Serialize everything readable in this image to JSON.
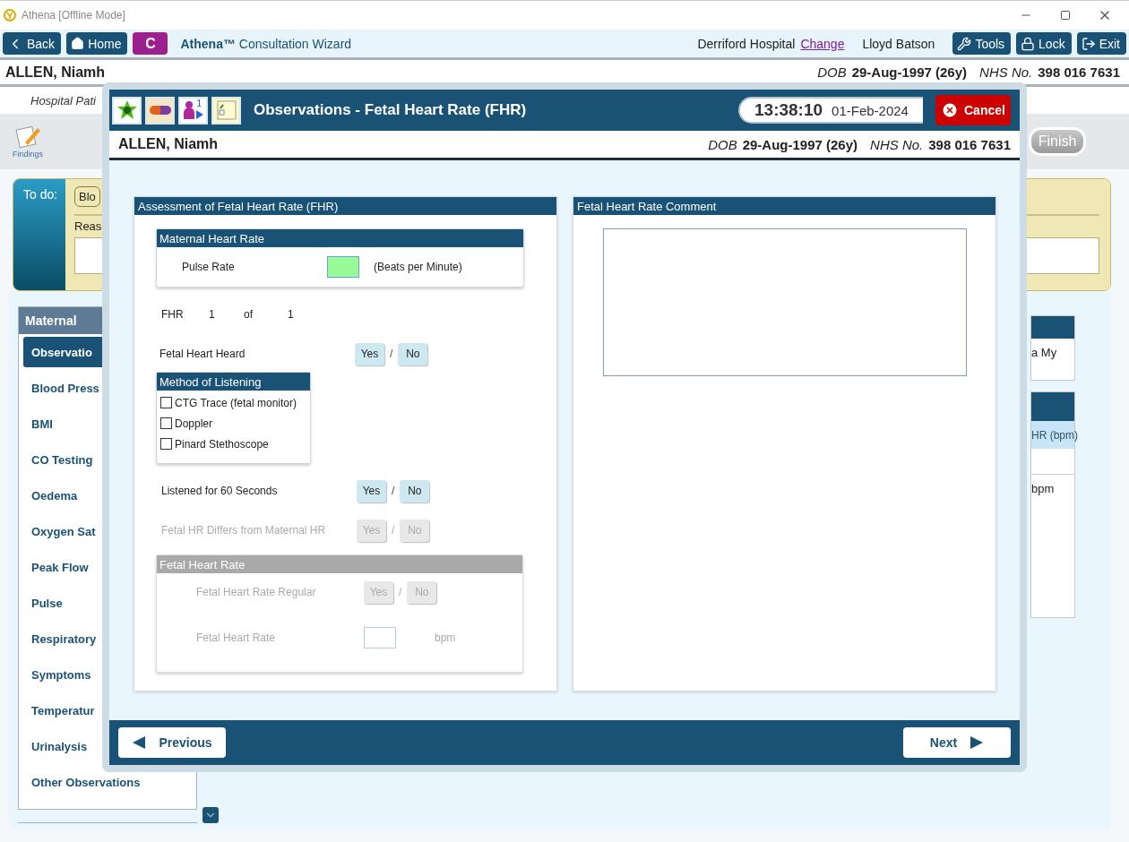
{
  "window": {
    "title": "Athena [Offline Mode]"
  },
  "toolbar": {
    "back": "Back",
    "home": "Home",
    "badge": "C",
    "app_name": "Athena™",
    "app_subtitle": "Consultation Wizard",
    "hospital": "Derriford Hospital",
    "change_link": "Change",
    "user": "Lloyd Batson",
    "buttons": [
      {
        "kind": "tools",
        "label": "Tools"
      },
      {
        "kind": "lock",
        "label": "Lock"
      },
      {
        "kind": "exit",
        "label": "Exit"
      }
    ]
  },
  "patient": {
    "name": "ALLEN, Niamh",
    "dob_label": "DOB",
    "dob": "29-Aug-1997 (26y)",
    "nhs_label": "NHS No.",
    "nhs": "398 016 7631"
  },
  "context_line": "Hospital Pati",
  "findings": {
    "label": "Findings"
  },
  "finish": {
    "label": "Finish",
    "disabled": true
  },
  "todo": {
    "title": "To do:",
    "item": "Blo",
    "reason_label": "Reas"
  },
  "sidebar": {
    "heading": "Maternal",
    "items": [
      {
        "label": "Observatio",
        "selected": true
      },
      {
        "label": "Blood Press",
        "selected": false
      },
      {
        "label": "BMI",
        "selected": false
      },
      {
        "label": "CO Testing",
        "selected": false
      },
      {
        "label": "Oedema",
        "selected": false
      },
      {
        "label": "Oxygen Sat",
        "selected": false
      },
      {
        "label": "Peak Flow",
        "selected": false
      },
      {
        "label": "Pulse",
        "selected": false
      },
      {
        "label": "Respiratory",
        "selected": false
      },
      {
        "label": "Symptoms",
        "selected": false
      },
      {
        "label": "Temperatur",
        "selected": false
      },
      {
        "label": "Urinalysis",
        "selected": false
      },
      {
        "label": "Other Observations",
        "selected": false
      }
    ]
  },
  "right_panels": {
    "panel_text": "a My",
    "table_header": "HR (bpm)",
    "table_cell": "bpm"
  },
  "dialog": {
    "queue_count": "1",
    "title": "Observations - Fetal Heart Rate (FHR)",
    "time": "13:38:10",
    "date": "01-Feb-2024",
    "cancel": "Cancel",
    "patient": {
      "name": "ALLEN, Niamh",
      "dob_label": "DOB",
      "dob": "29-Aug-1997 (26y)",
      "nhs_label": "NHS No.",
      "nhs": "398 016 7631"
    },
    "assessment": {
      "title": "Assessment of Fetal Heart Rate (FHR)",
      "maternal": {
        "title": "Maternal Heart Rate",
        "pulse_label": "Pulse Rate",
        "pulse_unit": "(Beats per Minute)"
      },
      "fhr_counter": [
        "FHR",
        "1",
        "of",
        "1"
      ],
      "questions": [
        {
          "label": "Fetal Heart Heard",
          "yes": "Yes",
          "separator": "/",
          "no": "No",
          "disabled": false
        },
        {
          "label": "Listened for 60 Seconds",
          "yes": "Yes",
          "separator": "/",
          "no": "No",
          "disabled": false
        },
        {
          "label": "Fetal HR Differs from Maternal HR",
          "yes": "Yes",
          "separator": "/",
          "no": "No",
          "disabled": true
        }
      ],
      "method": {
        "title": "Method of Listening",
        "options": [
          {
            "label": "CTG Trace (fetal monitor)",
            "checked": false
          },
          {
            "label": "Doppler",
            "checked": false
          },
          {
            "label": "Pinard Stethoscope",
            "checked": false
          }
        ]
      },
      "fhr_group": {
        "title": "Fetal Heart Rate",
        "disabled": true,
        "regular": {
          "label": "Fetal Heart Rate Regular",
          "yes": "Yes",
          "separator": "/",
          "no": "No"
        },
        "rate_label": "Fetal Heart Rate",
        "rate_unit": "bpm"
      }
    },
    "comment": {
      "title": "Fetal Heart Rate Comment"
    },
    "previous": "Previous",
    "next": "Next"
  }
}
